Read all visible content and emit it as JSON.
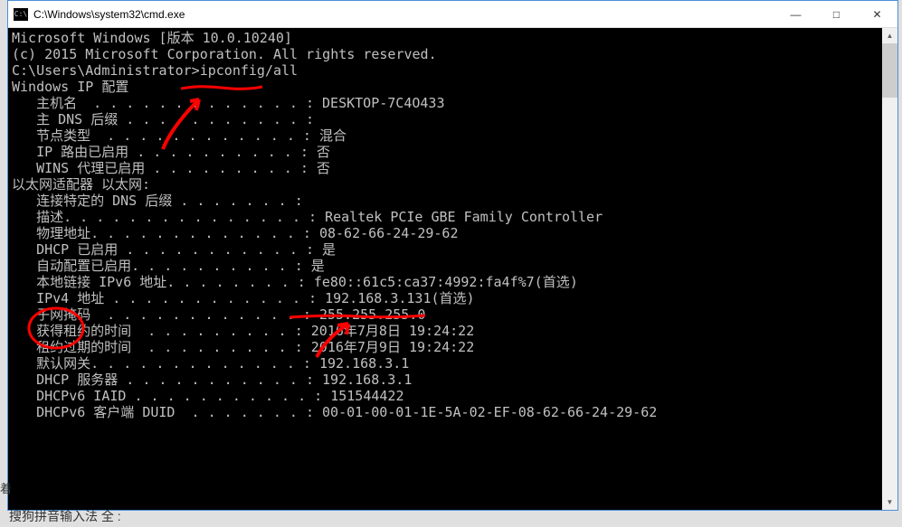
{
  "window": {
    "title": "C:\\Windows\\system32\\cmd.exe",
    "icon_label": "cmd"
  },
  "controls": {
    "minimize": "—",
    "maximize": "□",
    "close": "✕"
  },
  "terminal": {
    "lines": [
      "Microsoft Windows [版本 10.0.10240]",
      "(c) 2015 Microsoft Corporation. All rights reserved.",
      "",
      "C:\\Users\\Administrator>ipconfig/all",
      "",
      "Windows IP 配置",
      "",
      "   主机名  . . . . . . . . . . . . . : DESKTOP-7C4O433",
      "   主 DNS 后缀 . . . . . . . . . . . :",
      "   节点类型  . . . . . . . . . . . . : 混合",
      "   IP 路由已启用 . . . . . . . . . . : 否",
      "   WINS 代理已启用 . . . . . . . . . : 否",
      "",
      "以太网适配器 以太网:",
      "",
      "   连接特定的 DNS 后缀 . . . . . . . :",
      "   描述. . . . . . . . . . . . . . . : Realtek PCIe GBE Family Controller",
      "   物理地址. . . . . . . . . . . . . : 08-62-66-24-29-62",
      "   DHCP 已启用 . . . . . . . . . . . : 是",
      "   自动配置已启用. . . . . . . . . . : 是",
      "   本地链接 IPv6 地址. . . . . . . . : fe80::61c5:ca37:4992:fa4f%7(首选)",
      "   IPv4 地址 . . . . . . . . . . . . : 192.168.3.131(首选)",
      "   子网掩码  . . . . . . . . . . . . : 255.255.255.0",
      "   获得租约的时间  . . . . . . . . . : 2016年7月8日 19:24:22",
      "   租约过期的时间  . . . . . . . . . : 2016年7月9日 19:24:22",
      "   默认网关. . . . . . . . . . . . . : 192.168.3.1",
      "   DHCP 服务器 . . . . . . . . . . . : 192.168.3.1",
      "   DHCPv6 IAID . . . . . . . . . . . : 151544422",
      "   DHCPv6 客户端 DUID  . . . . . . . : 00-01-00-01-1E-5A-02-EF-08-62-66-24-29-62"
    ]
  },
  "taskbar": {
    "ime_text": "搜狗拼音输入法 全 :"
  },
  "left_label": "着"
}
